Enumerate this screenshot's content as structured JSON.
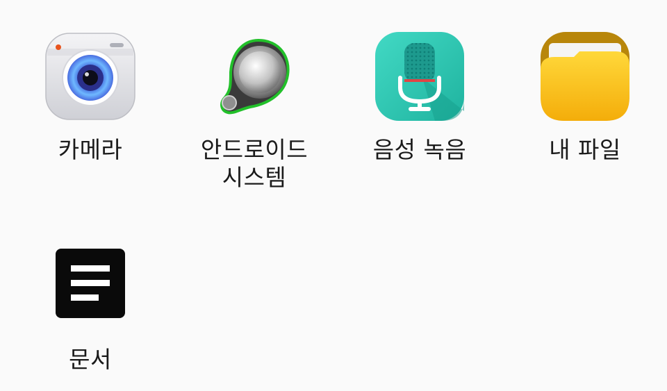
{
  "apps": [
    {
      "label": "카메라",
      "icon": "camera-icon"
    },
    {
      "label": "안드로이드\n시스템",
      "icon": "android-system-icon"
    },
    {
      "label": "음성 녹음",
      "icon": "voice-recorder-icon"
    },
    {
      "label": "내 파일",
      "icon": "my-files-icon"
    },
    {
      "label": "문서",
      "icon": "documents-icon"
    }
  ],
  "colors": {
    "background": "#fafafa",
    "recorder_teal": "#2fc9b4",
    "folder_yellow": "#fbc21b",
    "android_green": "#22c02a"
  }
}
